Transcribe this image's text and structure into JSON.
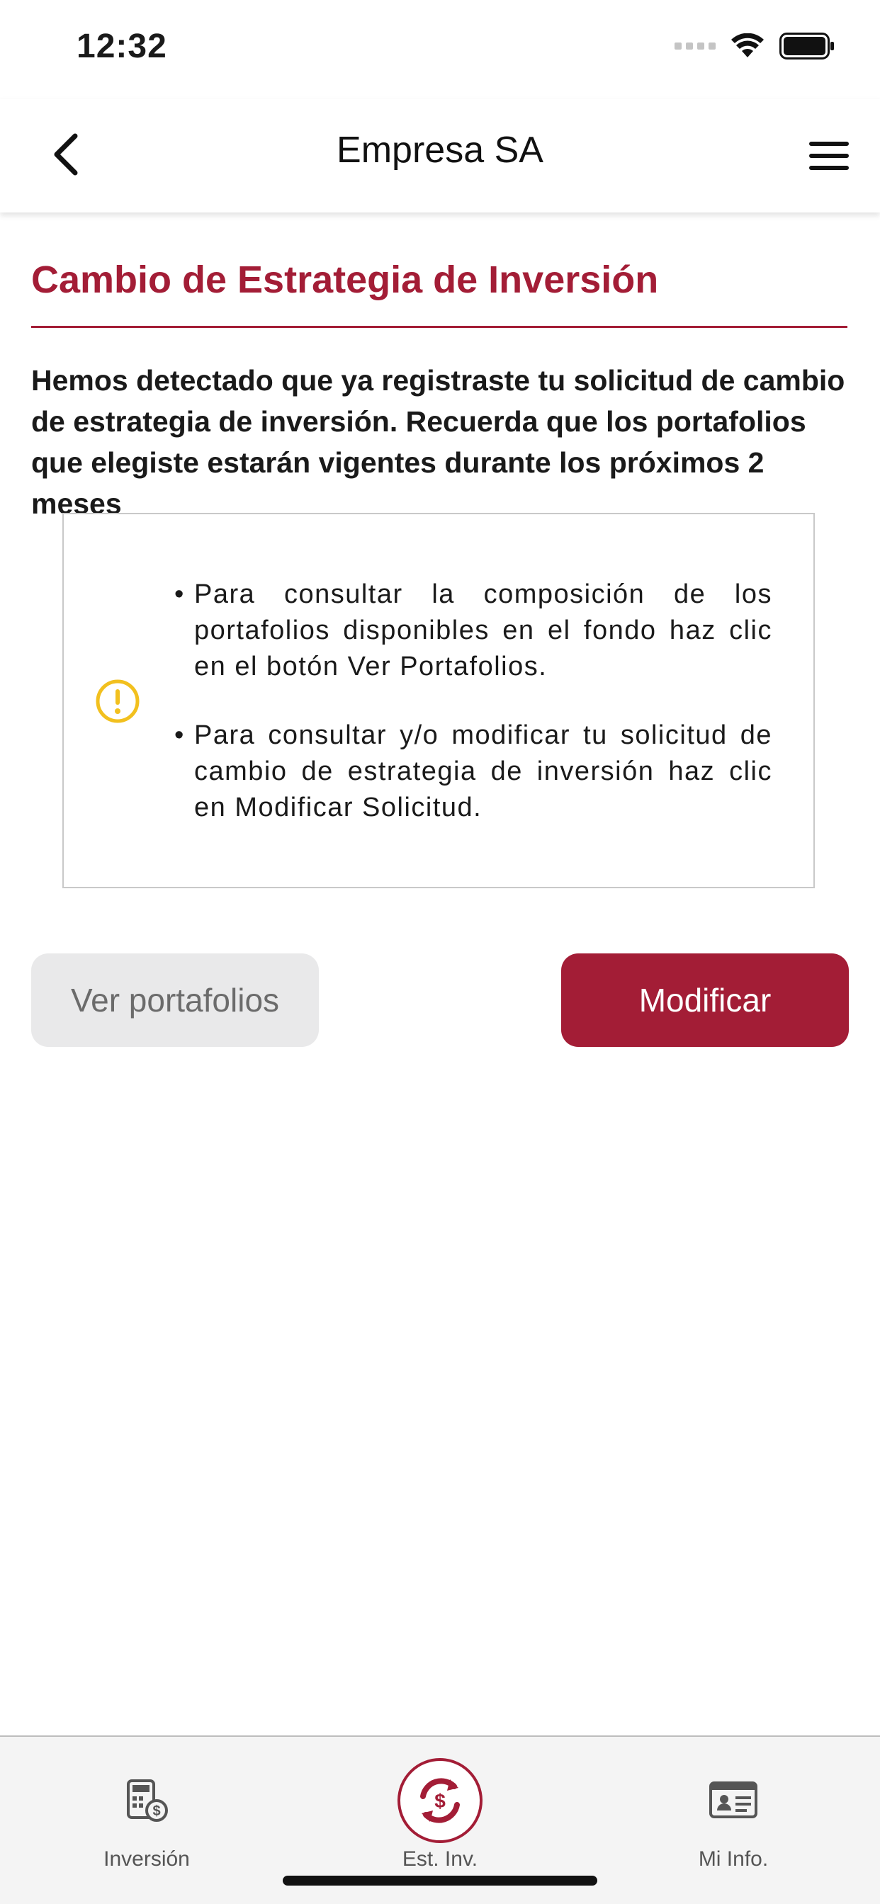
{
  "status_bar": {
    "time": "12:32"
  },
  "header": {
    "title": "Empresa SA"
  },
  "page": {
    "title": "Cambio de Estrategia de Inversión",
    "intro": "Hemos detectado que ya registraste tu solicitud de cambio de estrategia de inversión. Recuerda que los portafolios que elegiste estarán vigentes durante los próximos 2 meses",
    "bullets": [
      "Para consultar la composición de los portafolios disponibles en el fondo haz clic en el botón Ver Portafolios.",
      "Para consultar y/o modificar tu solicitud de cambio de estrategia de inversión haz clic en Modificar Solicitud."
    ]
  },
  "actions": {
    "secondary_label": "Ver portafolios",
    "primary_label": "Modificar"
  },
  "tab_bar": {
    "items": [
      {
        "label": "Inversión",
        "icon": "investment-calculator-icon"
      },
      {
        "label": "Est. Inv.",
        "icon": "strategy-exchange-icon",
        "active": true
      },
      {
        "label": "Mi Info.",
        "icon": "id-card-icon"
      }
    ]
  },
  "colors": {
    "brand": "#a31d36",
    "warning": "#f2c01e",
    "secondary_button_bg": "#e9e9ea"
  }
}
